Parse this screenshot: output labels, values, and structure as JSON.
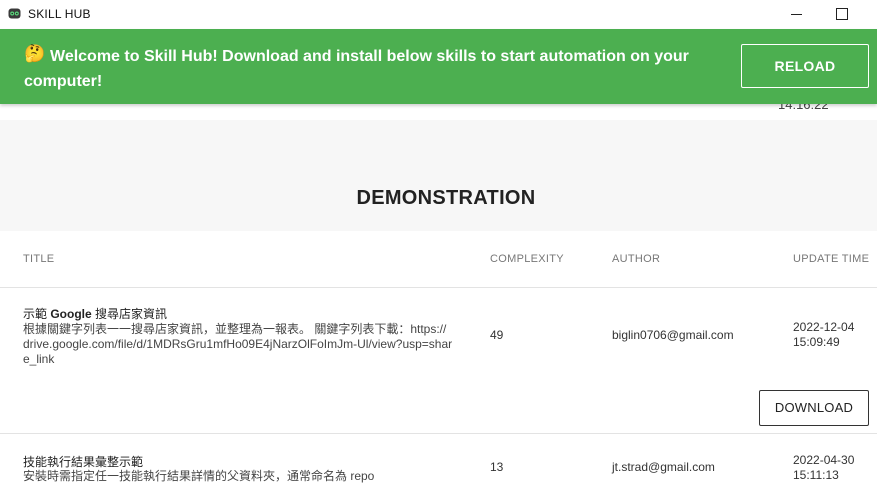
{
  "window": {
    "title": "SKILL HUB",
    "icon": "skill-hub-logo"
  },
  "banner": {
    "emoji": "🤔",
    "message": "Welcome to Skill Hub! Download and install below skills to start automation on your computer!",
    "reload_label": "RELOAD",
    "color": "#4caf50"
  },
  "previous_row": {
    "time_fragment": "14:16:22"
  },
  "section": {
    "title": "DEMONSTRATION"
  },
  "table": {
    "headers": {
      "title": "TITLE",
      "complexity": "COMPLEXITY",
      "author": "AUTHOR",
      "update_time": "UPDATE TIME"
    },
    "rows": [
      {
        "title_prefix": "示範 ",
        "title_bold": "Google",
        "title_suffix": " 搜尋店家資訊",
        "description": "根據關鍵字列表一一搜尋店家資訊，並整理為一報表。 關鍵字列表下載：https://drive.google.com/file/d/1MDRsGru1mfHo09E4jNarzOlFoImJm-Ul/view?usp=share_link",
        "complexity": "49",
        "author": "biglin0706@gmail.com",
        "date": "2022-12-04",
        "time": "15:09:49",
        "download_label": "DOWNLOAD"
      },
      {
        "title": "技能執行結果彙整示範",
        "description": "安裝時需指定任一技能執行結果詳情的父資料夾，通常命名為 repo",
        "complexity": "13",
        "author": "jt.strad@gmail.com",
        "date": "2022-04-30",
        "time": "15:11:13"
      }
    ]
  }
}
